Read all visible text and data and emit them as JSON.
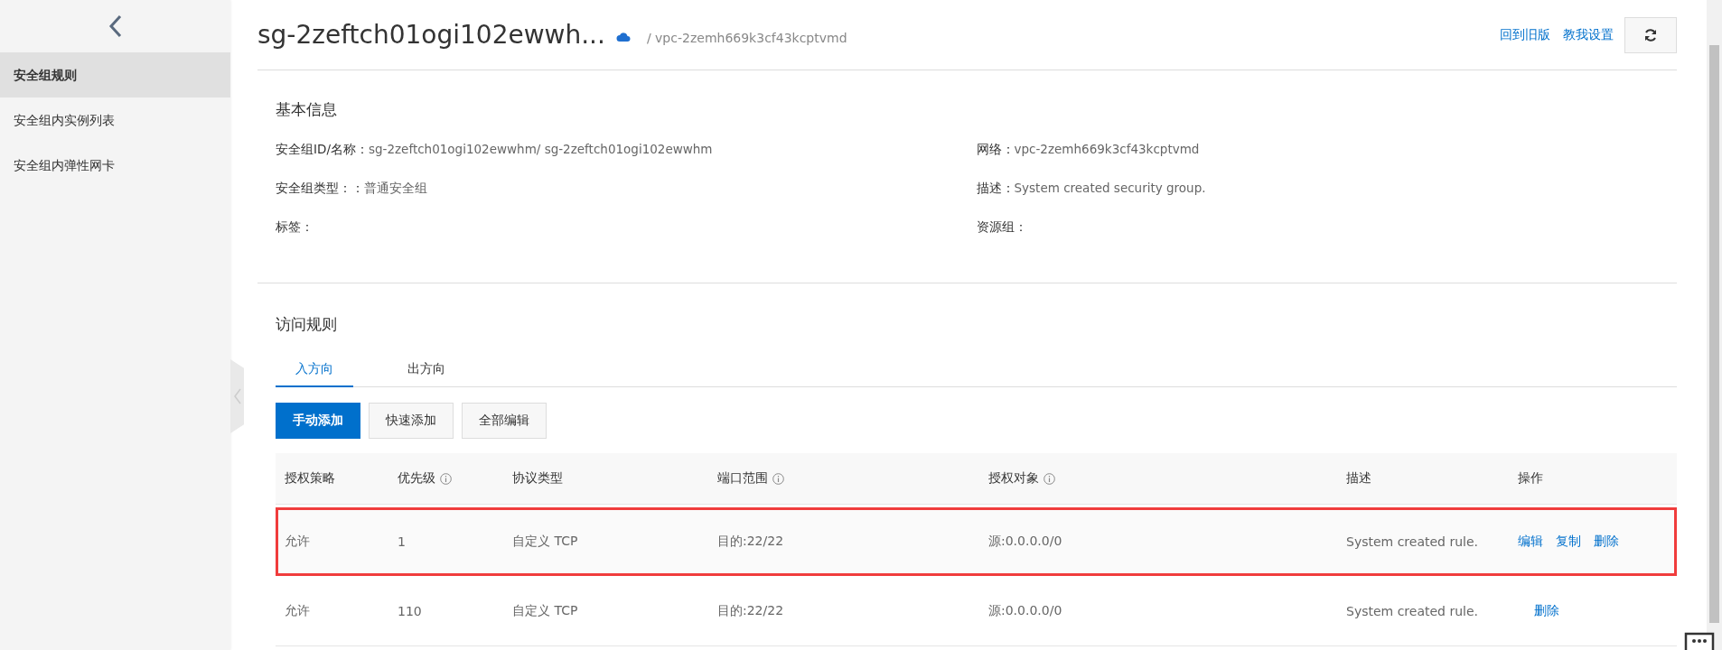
{
  "sidebar": {
    "items": [
      {
        "label": "安全组规则",
        "selected": true
      },
      {
        "label": "安全组内实例列表",
        "selected": false
      },
      {
        "label": "安全组内弹性网卡",
        "selected": false
      }
    ]
  },
  "header": {
    "title": "sg-2zeftch01ogi102ewwh...",
    "vpc": "/ vpc-2zemh669k3cf43kcptvmd",
    "links": [
      "回到旧版",
      "教我设置"
    ]
  },
  "basic_info": {
    "title": "基本信息",
    "left": [
      {
        "label": "安全组ID/名称：",
        "value": "sg-2zeftch01ogi102ewwhm/ sg-2zeftch01ogi102ewwhm"
      },
      {
        "label": "安全组类型：：",
        "value": "普通安全组"
      },
      {
        "label": "标签："
      }
    ],
    "right": [
      {
        "label": "网络：",
        "value": "vpc-2zemh669k3cf43kcptvmd"
      },
      {
        "label": "描述：",
        "value": "System created security group."
      },
      {
        "label": "资源组："
      }
    ]
  },
  "rules": {
    "title": "访问规则",
    "tabs": [
      {
        "label": "入方向",
        "selected": true
      },
      {
        "label": "出方向",
        "selected": false
      }
    ],
    "buttons": [
      {
        "label": "手动添加",
        "primary": true
      },
      {
        "label": "快速添加",
        "primary": false
      },
      {
        "label": "全部编辑",
        "primary": false
      }
    ],
    "columns": [
      {
        "label": "授权策略",
        "info": false
      },
      {
        "label": "优先级",
        "info": true
      },
      {
        "label": "协议类型",
        "info": false
      },
      {
        "label": "端口范围",
        "info": true
      },
      {
        "label": "授权对象",
        "info": true
      },
      {
        "label": "描述",
        "info": false
      },
      {
        "label": "操作",
        "info": false
      }
    ],
    "rows": [
      {
        "cells": [
          "允许",
          "1",
          "自定义 TCP",
          "目的:22/22",
          "源:0.0.0.0/0",
          "System created rule."
        ],
        "actions": [
          "编辑",
          "复制",
          "删除"
        ],
        "highlighted": true
      },
      {
        "cells": [
          "允许",
          "110",
          "自定义 TCP",
          "目的:22/22",
          "源:0.0.0.0/0",
          "System created rule."
        ],
        "actions": [
          "删除"
        ],
        "highlighted": false
      }
    ]
  }
}
